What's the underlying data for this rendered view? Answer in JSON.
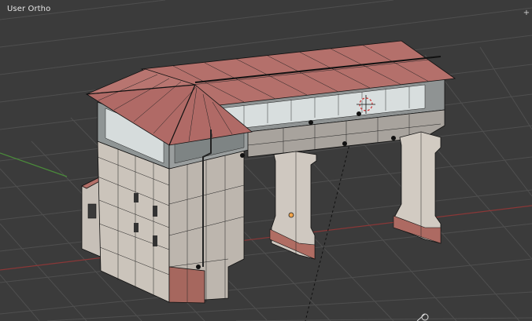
{
  "viewport": {
    "view_label": "User Ortho",
    "corner_widget_glyph": "+",
    "background_color": "#3b3b3b",
    "grid_color": "#555555",
    "x_axis_color": "#9b3a3a",
    "y_axis_color": "#4f8a3b"
  },
  "model": {
    "roof_color": "#b06a66",
    "wall_color": "#d3cbc2",
    "pillar_color": "#cfc8c0",
    "window_color": "#cfd6d6",
    "wire_color": "#111111"
  },
  "icons": [
    "3d-cursor-icon",
    "origin-point-icon",
    "corner-split-icon"
  ]
}
